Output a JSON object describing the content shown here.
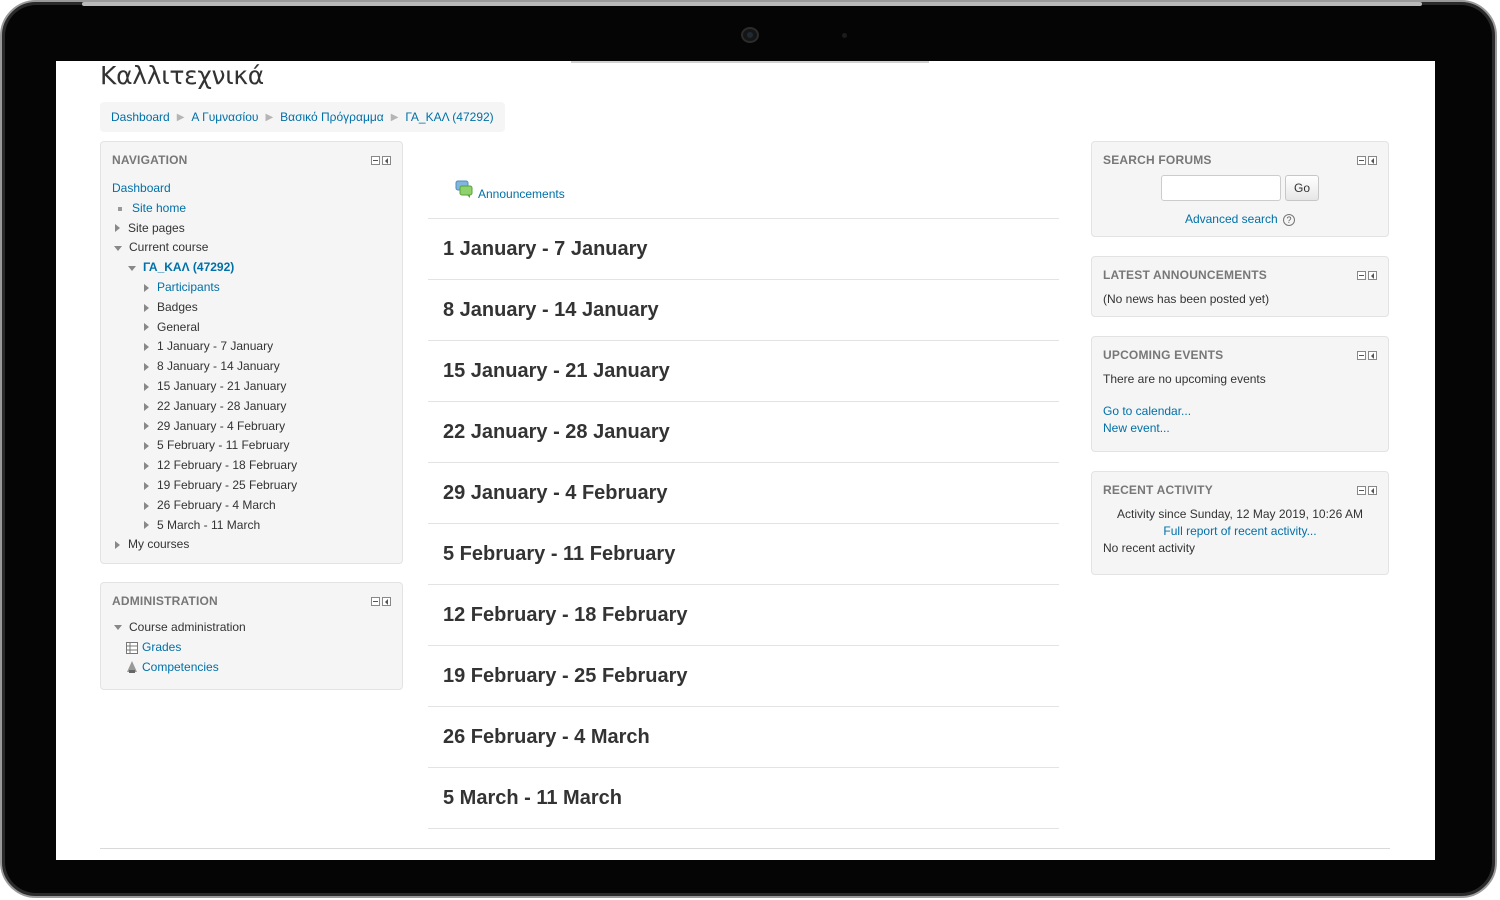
{
  "page": {
    "title": "Καλλιτεχνικά",
    "breadcrumb": [
      "Dashboard",
      "Α Γυμνασίου",
      "Βασικό Πρόγραμμα",
      "ΓΑ_ΚΑΛ (47292)"
    ],
    "breadcrumb_separator": "▶"
  },
  "navigation": {
    "title": "NAVIGATION",
    "dashboard": "Dashboard",
    "site_home": "Site home",
    "site_pages": "Site pages",
    "current_course": "Current course",
    "course_name": "ΓΑ_ΚΑΛ (47292)",
    "course_items": [
      "Participants",
      "Badges",
      "General",
      "1 January - 7 January",
      "8 January - 14 January",
      "15 January - 21 January",
      "22 January - 28 January",
      "29 January - 4 February",
      "5 February - 11 February",
      "12 February - 18 February",
      "19 February - 25 February",
      "26 February - 4 March",
      "5 March - 11 March"
    ],
    "my_courses": "My courses"
  },
  "administration": {
    "title": "ADMINISTRATION",
    "course_admin": "Course administration",
    "grades": "Grades",
    "competencies": "Competencies"
  },
  "main": {
    "announcements": "Announcements",
    "sections": [
      "1 January - 7 January",
      "8 January - 14 January",
      "15 January - 21 January",
      "22 January - 28 January",
      "29 January - 4 February",
      "5 February - 11 February",
      "12 February - 18 February",
      "19 February - 25 February",
      "26 February - 4 March",
      "5 March - 11 March"
    ]
  },
  "search_forums": {
    "title": "SEARCH FORUMS",
    "input_value": "",
    "go_label": "Go",
    "advanced_search": "Advanced search",
    "help_glyph": "?"
  },
  "latest_announcements": {
    "title": "LATEST ANNOUNCEMENTS",
    "text": "(No news has been posted yet)"
  },
  "upcoming_events": {
    "title": "UPCOMING EVENTS",
    "text": "There are no upcoming events",
    "go_to_calendar": "Go to calendar...",
    "new_event": "New event..."
  },
  "recent_activity": {
    "title": "RECENT ACTIVITY",
    "since": "Activity since Sunday, 12 May 2019, 10:26 AM",
    "full_report": "Full report of recent activity...",
    "no_activity": "No recent activity"
  },
  "colors": {
    "link": "#0070a8",
    "block_bg": "#f5f5f5",
    "text": "#333333"
  }
}
